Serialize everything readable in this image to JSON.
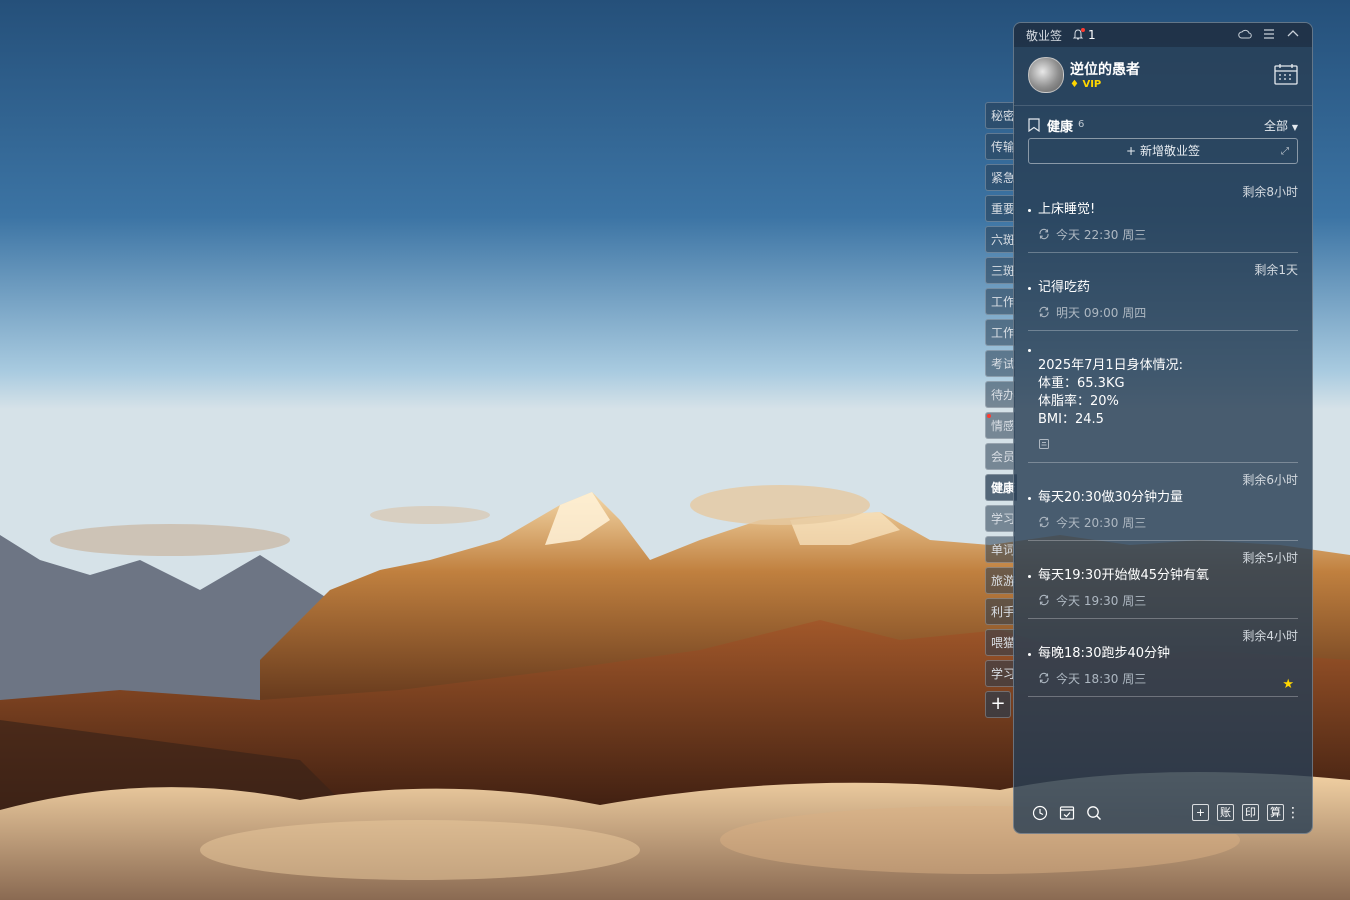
{
  "window": {
    "title": "敬业签",
    "notification_count": "1"
  },
  "profile": {
    "username": "逆位的愚者",
    "badge": "VIP"
  },
  "side_tabs": [
    "秘密",
    "传输",
    "紧急",
    "重要",
    "六斑",
    "三斑",
    "工作",
    "工作",
    "考试",
    "待办",
    "情感",
    "会员",
    "健康",
    "学习",
    "单词",
    "旅游",
    "利手",
    "喂猫",
    "学习"
  ],
  "side_tab_active_index": 12,
  "side_add_label": "+",
  "section": {
    "title": "健康",
    "count": "6",
    "filter": "全部",
    "new_button": "新增敬业签"
  },
  "items": [
    {
      "remain": "剩余8小时",
      "text": "上床睡觉!",
      "time": "今天 22:30 周三",
      "repeat": true,
      "star": false
    },
    {
      "remain": "剩余1天",
      "text": "记得吃药",
      "time": "明天 09:00 周四",
      "repeat": true,
      "star": false
    },
    {
      "remain": "",
      "text": "2025年7月1日身体情况:",
      "lines": [
        "体重：65.3KG",
        "体脂率：20%",
        "BMI：24.5"
      ],
      "time": "",
      "repeat": false,
      "star": false
    },
    {
      "remain": "剩余6小时",
      "text": "每天20:30做30分钟力量",
      "time": "今天 20:30 周三",
      "repeat": true,
      "star": false
    },
    {
      "remain": "剩余5小时",
      "text": "每天19:30开始做45分钟有氧",
      "time": "今天 19:30 周三",
      "repeat": true,
      "star": false
    },
    {
      "remain": "剩余4小时",
      "text": "每晚18:30跑步40分钟",
      "time": "今天 18:30 周三",
      "repeat": true,
      "star": true
    }
  ],
  "toolbar": {
    "box_buttons": [
      "+",
      "账",
      "印",
      "算"
    ],
    "more": "⋮"
  },
  "colors": {
    "panel_bg": "#283e54",
    "accent_red": "#ff3b30",
    "vip_yellow": "#ffd600"
  }
}
